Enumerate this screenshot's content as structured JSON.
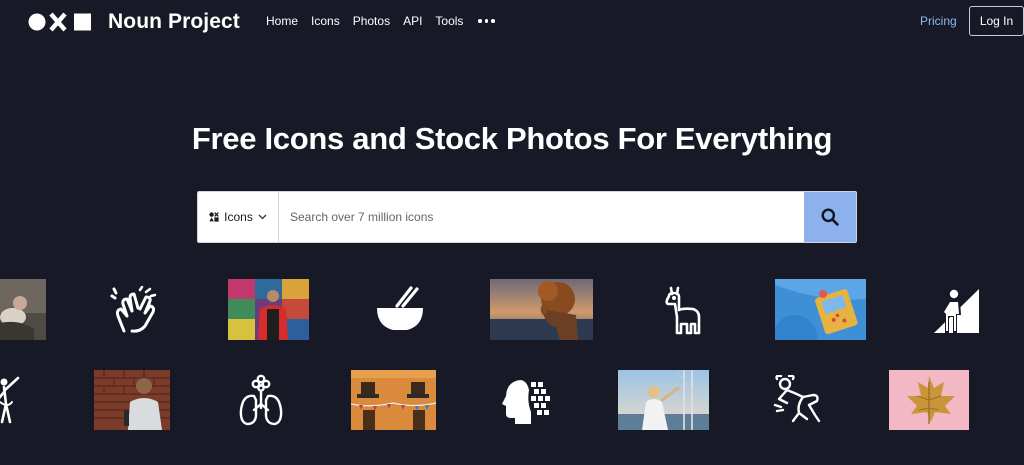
{
  "header": {
    "brand": "Noun Project",
    "nav": [
      "Home",
      "Icons",
      "Photos",
      "API",
      "Tools"
    ],
    "pricing": "Pricing",
    "login": "Log In"
  },
  "hero": {
    "title": "Free Icons and Stock Photos For Everything"
  },
  "search": {
    "type_label": "Icons",
    "placeholder": "Search over 7 million icons",
    "value": ""
  },
  "gallery": {
    "row1": [
      "photo-person-sitting",
      "clapping-hands-icon",
      "photo-man-red-jacket",
      "bowl-chopsticks-icon",
      "photo-curly-hair-sunset",
      "llama-icon",
      "photo-blue-table-food",
      "climber-wall-icon"
    ],
    "row2": [
      "dancer-icon",
      "photo-man-brick-wall",
      "lungs-flower-icon",
      "photo-orange-building-balconies",
      "head-pixels-icon",
      "photo-woman-sailboat",
      "wrestler-icon",
      "photo-gold-leaf-pink"
    ]
  },
  "colors": {
    "background": "#171a26",
    "accent_blue": "#8cb1ec",
    "pricing_link": "#8eb8f0"
  }
}
